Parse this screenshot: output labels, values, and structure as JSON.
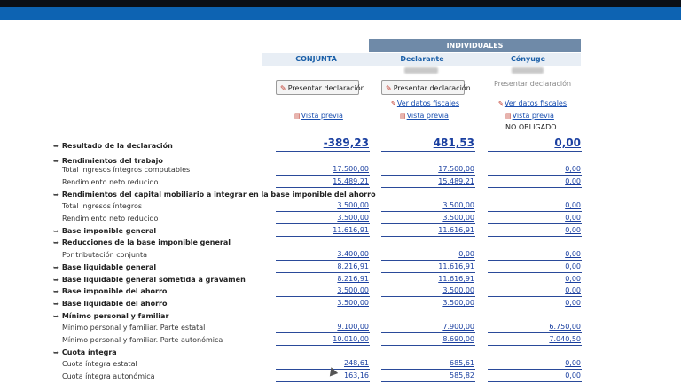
{
  "header": {
    "individuales": "INDIVIDUALES",
    "conjunta": "CONJUNTA",
    "declarante": "Declarante",
    "conyuge": "Cónyuge"
  },
  "actions": {
    "presentar_conjunta": "Presentar declaración",
    "presentar_declarante": "Presentar declaración",
    "presentar_conyuge": "Presentar declaración",
    "ver_datos_declarante": "Ver datos fiscales",
    "ver_datos_conyuge": "Ver datos fiscales",
    "vista_previa_conjunta": "Vista previa",
    "vista_previa_declarante": "Vista previa",
    "vista_previa_conyuge": "Vista previa",
    "no_obligado": "NO OBLIGADO"
  },
  "rows": [
    {
      "label": "Resultado de la declaración",
      "bold": true,
      "arrow": true,
      "values": [
        "-389,23",
        "481,53",
        "0,00"
      ],
      "big": true
    },
    {
      "label": "Rendimientos del trabajo",
      "bold": true,
      "arrow": true,
      "values": null
    },
    {
      "label": "Total ingresos íntegros computables",
      "bold": false,
      "arrow": false,
      "values": [
        "17.500,00",
        "17.500,00",
        "0,00"
      ]
    },
    {
      "label": "Rendimiento neto reducido",
      "bold": false,
      "arrow": false,
      "values": [
        "15.489,21",
        "15.489,21",
        "0,00"
      ]
    },
    {
      "label": "Rendimientos del capital mobiliario a integrar en la base imponible del ahorro",
      "bold": true,
      "arrow": true,
      "values": null
    },
    {
      "label": "Total ingresos íntegros",
      "bold": false,
      "arrow": false,
      "values": [
        "3.500,00",
        "3.500,00",
        "0,00"
      ]
    },
    {
      "label": "Rendimiento neto reducido",
      "bold": false,
      "arrow": false,
      "values": [
        "3.500,00",
        "3.500,00",
        "0,00"
      ]
    },
    {
      "label": "Base imponible general",
      "bold": true,
      "arrow": true,
      "values": [
        "11.616,91",
        "11.616,91",
        "0,00"
      ]
    },
    {
      "label": "Reducciones de la base imponible general",
      "bold": true,
      "arrow": true,
      "values": null
    },
    {
      "label": "Por tributación conjunta",
      "bold": false,
      "arrow": false,
      "values": [
        "3.400,00",
        "0,00",
        "0,00"
      ]
    },
    {
      "label": "Base liquidable general",
      "bold": true,
      "arrow": true,
      "values": [
        "8.216,91",
        "11.616,91",
        "0,00"
      ]
    },
    {
      "label": "Base liquidable general sometida a gravamen",
      "bold": true,
      "arrow": true,
      "values": [
        "8.216,91",
        "11.616,91",
        "0,00"
      ]
    },
    {
      "label": "Base imponible del ahorro",
      "bold": true,
      "arrow": true,
      "values": [
        "3.500,00",
        "3.500,00",
        "0,00"
      ]
    },
    {
      "label": "Base liquidable del ahorro",
      "bold": true,
      "arrow": true,
      "values": [
        "3.500,00",
        "3.500,00",
        "0,00"
      ]
    },
    {
      "label": "Mínimo personal y familiar",
      "bold": true,
      "arrow": true,
      "values": null
    },
    {
      "label": "Mínimo personal y familiar. Parte estatal",
      "bold": false,
      "arrow": false,
      "values": [
        "9.100,00",
        "7.900,00",
        "6.750,00"
      ]
    },
    {
      "label": "Mínimo personal y familiar. Parte autonómica",
      "bold": false,
      "arrow": false,
      "values": [
        "10.010,00",
        "8.690,00",
        "7.040,50"
      ]
    },
    {
      "label": "Cuota íntegra",
      "bold": true,
      "arrow": true,
      "values": null
    },
    {
      "label": "Cuota íntegra estatal",
      "bold": false,
      "arrow": false,
      "values": [
        "248,61",
        "685,61",
        "0,00"
      ]
    },
    {
      "label": "Cuota íntegra autonómica",
      "bold": false,
      "arrow": false,
      "values": [
        "163,16",
        "585,82",
        "0,00"
      ]
    }
  ]
}
